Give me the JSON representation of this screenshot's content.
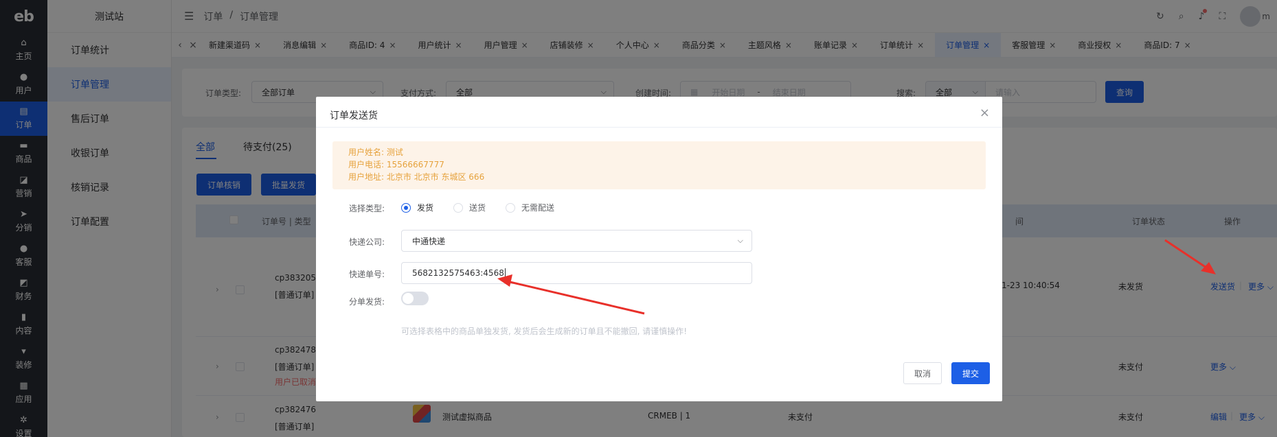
{
  "rail": {
    "logo": "eb",
    "items": [
      {
        "label": "主页",
        "icon": "home-icon",
        "glyph": "⌂"
      },
      {
        "label": "用户",
        "icon": "user-icon",
        "glyph": "●"
      },
      {
        "label": "订单",
        "icon": "order-icon",
        "glyph": "▤"
      },
      {
        "label": "商品",
        "icon": "goods-icon",
        "glyph": "▬"
      },
      {
        "label": "营销",
        "icon": "marketing-icon",
        "glyph": "◪"
      },
      {
        "label": "分销",
        "icon": "distribution-icon",
        "glyph": "➤"
      },
      {
        "label": "客服",
        "icon": "service-icon",
        "glyph": "●"
      },
      {
        "label": "财务",
        "icon": "finance-icon",
        "glyph": "◩"
      },
      {
        "label": "内容",
        "icon": "content-icon",
        "glyph": "▮"
      },
      {
        "label": "装修",
        "icon": "decorate-icon",
        "glyph": "▾"
      },
      {
        "label": "应用",
        "icon": "apps-icon",
        "glyph": "▦"
      },
      {
        "label": "设置",
        "icon": "settings-icon",
        "glyph": "✲"
      }
    ]
  },
  "submenu": {
    "title": "测试站",
    "items": [
      "订单统计",
      "订单管理",
      "售后订单",
      "收银订单",
      "核销记录",
      "订单配置"
    ]
  },
  "header": {
    "breadcrumb": [
      "订单",
      "/",
      "订单管理"
    ],
    "avatar_text": "m"
  },
  "tabs": [
    "新建渠道码",
    "消息编辑",
    "商品ID: 4",
    "用户统计",
    "用户管理",
    "店铺装修",
    "个人中心",
    "商品分类",
    "主题风格",
    "账单记录",
    "订单统计",
    "订单管理",
    "客服管理",
    "商业授权",
    "商品ID: 7"
  ],
  "filter": {
    "order_type_label": "订单类型:",
    "order_type_value": "全部订单",
    "pay_label": "支付方式:",
    "pay_value": "全部",
    "time_label": "创建时间:",
    "start_placeholder": "开始日期",
    "dash": "-",
    "end_placeholder": "结束日期",
    "search_label": "搜索:",
    "search_scope": "全部",
    "search_placeholder": "请输入",
    "query_button": "查询"
  },
  "list": {
    "tabs": [
      "全部",
      "待支付(25)"
    ],
    "buttons": [
      "订单核销",
      "批量发货"
    ],
    "columns": {
      "order_no": "订单号 | 类型",
      "time": "间",
      "status": "订单状态",
      "action": "操作"
    },
    "rows": [
      {
        "order_no": "cp383205",
        "type": "[普通订单]",
        "time": "1-23 10:40:54",
        "status": "未发货",
        "actions": [
          "发送货",
          "更多"
        ],
        "note": ""
      },
      {
        "order_no": "cp382478",
        "type": "[普通订单]",
        "time": "",
        "status": "未支付",
        "actions": [
          "更多"
        ],
        "note": "用户已取消"
      },
      {
        "order_no": "cp382476",
        "type": "[普通订单]",
        "goods": "测试虚拟商品",
        "user": "CRMEB | 1",
        "pay_status": "未支付",
        "status": "未支付",
        "actions": [
          "编辑",
          "更多"
        ],
        "note": ""
      }
    ]
  },
  "dialog": {
    "title": "订单发送货",
    "notice": [
      "用户姓名: 测试",
      "用户电话: 15566667777",
      "用户地址: 北京市 北京市 东城区 666"
    ],
    "type_label": "选择类型:",
    "type_options": [
      "发货",
      "送货",
      "无需配送"
    ],
    "company_label": "快递公司:",
    "company_value": "中通快递",
    "tracking_label": "快递单号:",
    "tracking_value": "5682132575463:4568",
    "split_label": "分单发货:",
    "split_hint": "可选择表格中的商品单独发货, 发货后会生成新的订单且不能撤回, 请谨慎操作!",
    "cancel": "取消",
    "submit": "提交"
  },
  "colors": {
    "accent": "#1d5fe6",
    "rail": "#282c34",
    "warning": "#e6a23c",
    "annotation": "#e8302a"
  }
}
